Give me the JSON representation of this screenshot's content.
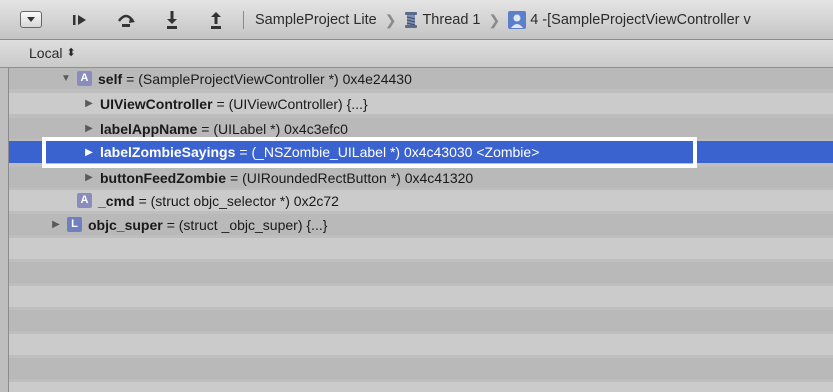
{
  "toolbar": {
    "breadcrumbs": {
      "project": "SampleProject Lite",
      "thread": "Thread 1",
      "frame": "4 -[SampleProjectViewController v"
    }
  },
  "scope": {
    "label": "Local",
    "arrows": "⬍"
  },
  "variables": [
    {
      "name": "self",
      "value": "= (SampleProjectViewController *) 0x4e24430",
      "badge": "A",
      "expanded": true
    },
    {
      "name": "UIViewController",
      "value": "= (UIViewController) {...}"
    },
    {
      "name": "labelAppName",
      "value": "= (UILabel *) 0x4c3efc0"
    },
    {
      "name": "labelZombieSayings",
      "value": "= (_NSZombie_UILabel *) 0x4c43030 <Zombie>",
      "selected": true
    },
    {
      "name": "buttonFeedZombie",
      "value": "= (UIRoundedRectButton *) 0x4c41320"
    },
    {
      "name": "_cmd",
      "value": "= (struct objc_selector *) 0x2c72",
      "badge": "A"
    },
    {
      "name": "objc_super",
      "value": "= (struct _objc_super) {...}",
      "badge": "L"
    }
  ],
  "colors": {
    "selection": "#3b63d0",
    "highlight_box": "#ffffff"
  }
}
